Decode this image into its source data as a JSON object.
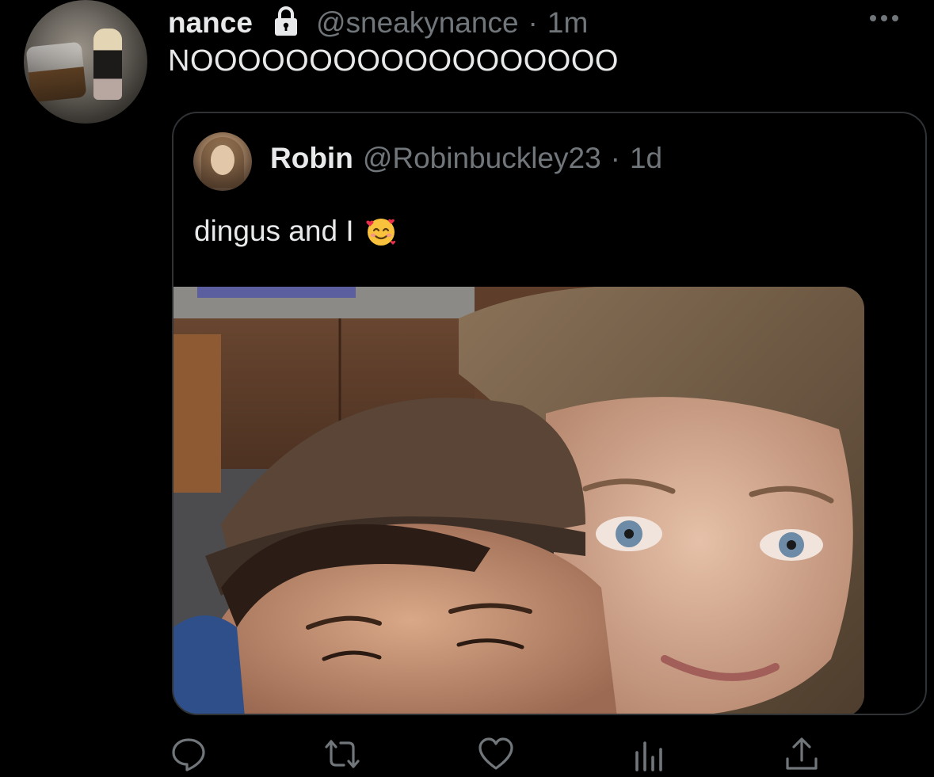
{
  "tweet": {
    "display_name": "nance",
    "handle": "@sneakynance",
    "separator": "·",
    "time": "1m",
    "text": "NOOOOOOOOOOOOOOOOOO"
  },
  "quoted_tweet": {
    "display_name": "Robin",
    "handle": "@Robinbuckley23",
    "separator": "·",
    "time": "1d",
    "text": "dingus and I",
    "emoji": "smiling-face-with-hearts-icon"
  },
  "actions": [
    {
      "name": "reply-icon"
    },
    {
      "name": "retweet-icon"
    },
    {
      "name": "like-icon"
    },
    {
      "name": "analytics-icon"
    },
    {
      "name": "share-icon"
    }
  ],
  "colors": {
    "background": "#000000",
    "primary_text": "#e7e9ea",
    "secondary_text": "#71767b",
    "border": "#2f3336"
  }
}
